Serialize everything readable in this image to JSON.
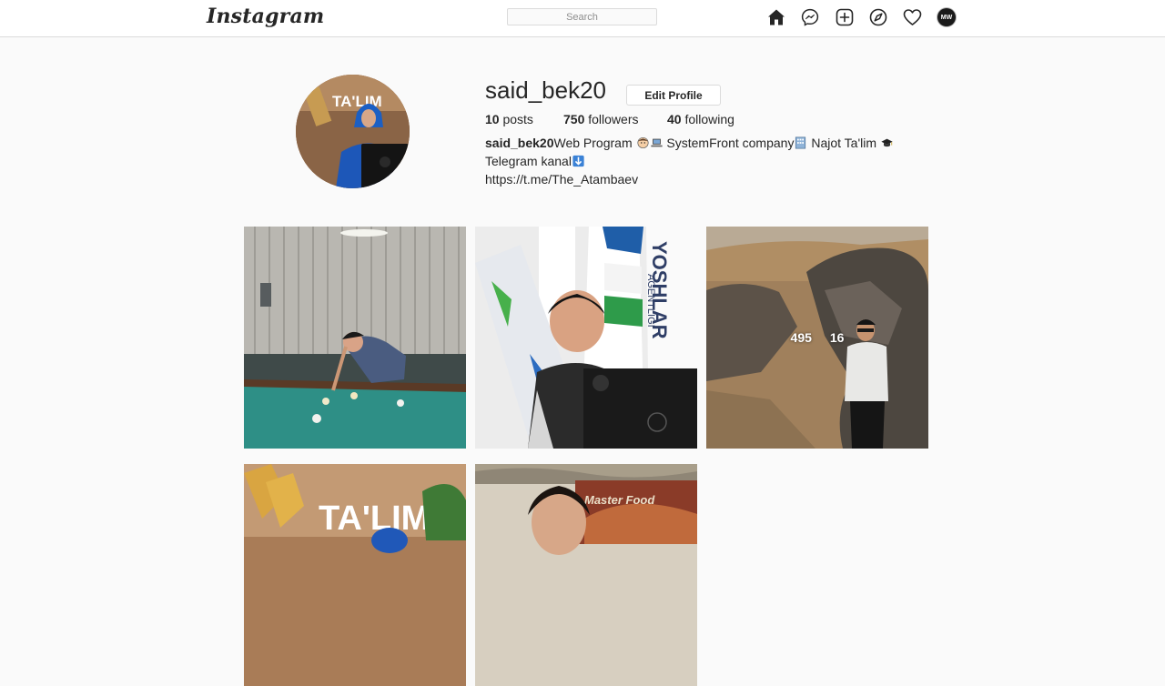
{
  "nav": {
    "logo": "Instagram",
    "search_placeholder": "Search",
    "icons": [
      "home-icon",
      "messenger-icon",
      "new-post-icon",
      "explore-icon",
      "activity-heart-icon"
    ],
    "avatar_text": "MW"
  },
  "profile": {
    "username": "said_bek20",
    "edit_label": "Edit Profile",
    "posts_count": "10",
    "posts_label": "posts",
    "followers_count": "750",
    "followers_label": "followers",
    "following_count": "40",
    "following_label": "following",
    "bio_name": "said_bek20",
    "bio_line1_a": "Web Program",
    "bio_line1_b": "SystemFront company",
    "bio_line1_c": "Najot Ta'lim",
    "bio_line2": "Telegram kanal",
    "bio_link": "https://t.me/The_Atambaev"
  },
  "posts": [
    {
      "id": "billiards"
    },
    {
      "id": "flags"
    },
    {
      "id": "rocks",
      "likes": "495",
      "comments": "16"
    },
    {
      "id": "talim-wall"
    },
    {
      "id": "restaurant"
    }
  ],
  "colors": {
    "background": "#fafafa",
    "border": "#dbdbdb",
    "text": "#262626",
    "muted": "#8e8e8e"
  }
}
